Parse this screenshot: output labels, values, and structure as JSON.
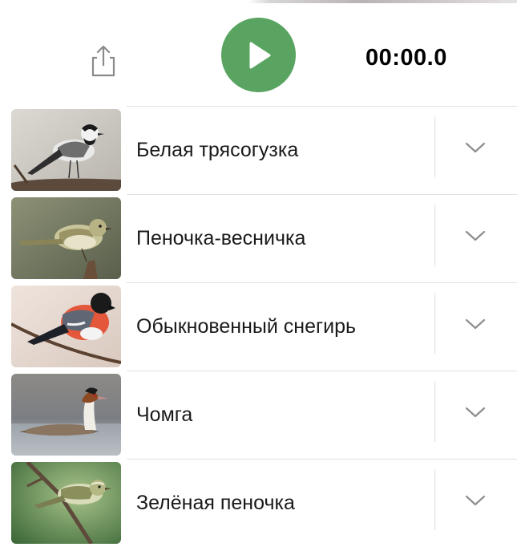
{
  "player": {
    "timer": "00:00.0",
    "share_icon": "share-icon",
    "play_icon": "play-icon",
    "accent_color": "#5aa462"
  },
  "birds": [
    {
      "name": "Белая трясогузка",
      "image": "white-wagtail-photo"
    },
    {
      "name": "Пеночка-весничка",
      "image": "willow-warbler-photo"
    },
    {
      "name": "Обыкновенный снегирь",
      "image": "bullfinch-photo"
    },
    {
      "name": "Чомга",
      "image": "great-crested-grebe-photo"
    },
    {
      "name": "Зелёная пеночка",
      "image": "greenish-warbler-photo"
    }
  ]
}
